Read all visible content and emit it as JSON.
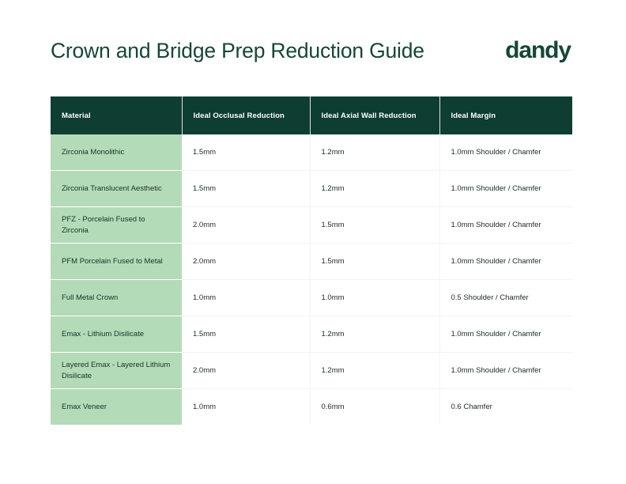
{
  "header": {
    "title": "Crown and Bridge Prep Reduction Guide",
    "brand": "dandy"
  },
  "colors": {
    "brand_dark_green": "#0e3d32",
    "title_green": "#154734",
    "row_light_green": "#b4dbb7",
    "body_text": "#1d2b26",
    "page_background": "#ffffff"
  },
  "table": {
    "columns": [
      "Material",
      "Ideal Occlusal Reduction",
      "Ideal Axial Wall Reduction",
      "Ideal Margin"
    ],
    "rows": [
      {
        "material": "Zirconia Monolithic",
        "occlusal": "1.5mm",
        "axial": "1.2mm",
        "margin": "1.0mm Shoulder / Chamfer"
      },
      {
        "material": "Zirconia Translucent Aesthetic",
        "occlusal": "1.5mm",
        "axial": "1.2mm",
        "margin": "1.0mm Shoulder / Chamfer"
      },
      {
        "material": "PFZ - Porcelain Fused to Zirconia",
        "occlusal": "2.0mm",
        "axial": "1.5mm",
        "margin": "1.0mm Shoulder / Chamfer"
      },
      {
        "material": "PFM Porcelain Fused to Metal",
        "occlusal": "2.0mm",
        "axial": "1.5mm",
        "margin": "1.0mm Shoulder / Chamfer"
      },
      {
        "material": "Full Metal Crown",
        "occlusal": "1.0mm",
        "axial": "1.0mm",
        "margin": "0.5 Shoulder / Chamfer"
      },
      {
        "material": "Emax - Lithium Disilicate",
        "occlusal": "1.5mm",
        "axial": "1.2mm",
        "margin": "1.0mm Shoulder / Chamfer"
      },
      {
        "material": "Layered Emax - Layered Lithium Disilicate",
        "occlusal": "2.0mm",
        "axial": "1.2mm",
        "margin": "1.0mm Shoulder / Chamfer"
      },
      {
        "material": "Emax Veneer",
        "occlusal": "1.0mm",
        "axial": "0.6mm",
        "margin": "0.6 Chamfer"
      }
    ]
  }
}
